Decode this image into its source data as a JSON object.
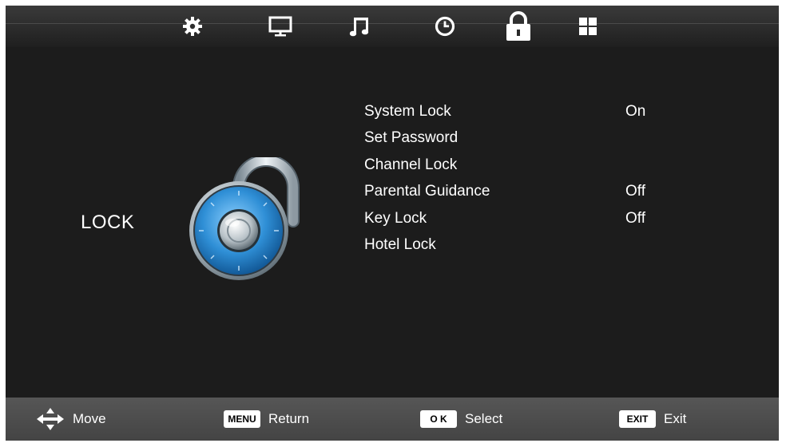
{
  "tabs": [
    {
      "icon": "gear-icon",
      "name": "tab-settings"
    },
    {
      "icon": "monitor-icon",
      "name": "tab-picture"
    },
    {
      "icon": "music-note-icon",
      "name": "tab-sound"
    },
    {
      "icon": "clock-icon",
      "name": "tab-time"
    },
    {
      "icon": "padlock-icon",
      "name": "tab-lock",
      "active": true
    },
    {
      "icon": "grid-icon",
      "name": "tab-apps"
    }
  ],
  "section": {
    "title": "LOCK"
  },
  "menu": {
    "items": [
      {
        "label": "System Lock",
        "value": "On"
      },
      {
        "label": "Set Password",
        "value": ""
      },
      {
        "label": "Channel Lock",
        "value": ""
      },
      {
        "label": "Parental Guidance",
        "value": "Off"
      },
      {
        "label": "Key Lock",
        "value": "Off"
      },
      {
        "label": "Hotel Lock",
        "value": ""
      }
    ]
  },
  "hints": {
    "move": {
      "text": "Move"
    },
    "return": {
      "key": "MENU",
      "text": "Return"
    },
    "select": {
      "key": "O K",
      "text": "Select"
    },
    "exit": {
      "key": "EXIT",
      "text": "Exit"
    }
  },
  "colors": {
    "background": "#1c1c1c",
    "text": "#ffffff",
    "accent_blue": "#2f8fd6"
  }
}
